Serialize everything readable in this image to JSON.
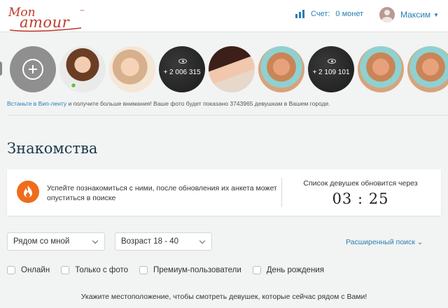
{
  "header": {
    "logo_top": "Mon",
    "logo_main": "amour",
    "logo_tm": "™",
    "balance_label": "Счет:",
    "balance_value": "0 монет",
    "username": "Максим"
  },
  "stories": {
    "items": [
      {
        "kind": "add"
      },
      {
        "kind": "photo"
      },
      {
        "kind": "photo"
      },
      {
        "kind": "hidden",
        "count": "+ 2 006 315"
      },
      {
        "kind": "photo"
      },
      {
        "kind": "photo"
      },
      {
        "kind": "hidden",
        "count": "+ 2 109 101"
      },
      {
        "kind": "photo"
      },
      {
        "kind": "photo"
      }
    ],
    "promo_link": "Встаньте в Вип-ленту",
    "promo_text": " и получите больше внимания! Ваше фото будет показано 3743965 девушкам в Вашем городе."
  },
  "page_title": "Знакомства",
  "notice": {
    "text": "Успейте познакомиться с ними, после обновления их анкета может опуститься в поиске",
    "timer_label": "Список девушек обновится через",
    "timer": "03 : 25"
  },
  "search": {
    "location_select": "Рядом со мной",
    "age_select": "Возраст 18 - 40",
    "advanced": "Расширенный поиск ⌄"
  },
  "filters": [
    "Онлайн",
    "Только с фото",
    "Премиум-пользователи",
    "День рождения"
  ],
  "location_message": "Укажите местоположение, чтобы смотреть девушек, которые сейчас рядом с Вами!",
  "colors": {
    "accent": "#2a7fb5",
    "brand": "#c0392b",
    "flame": "#ef6c1c",
    "online": "#6cc04a"
  }
}
